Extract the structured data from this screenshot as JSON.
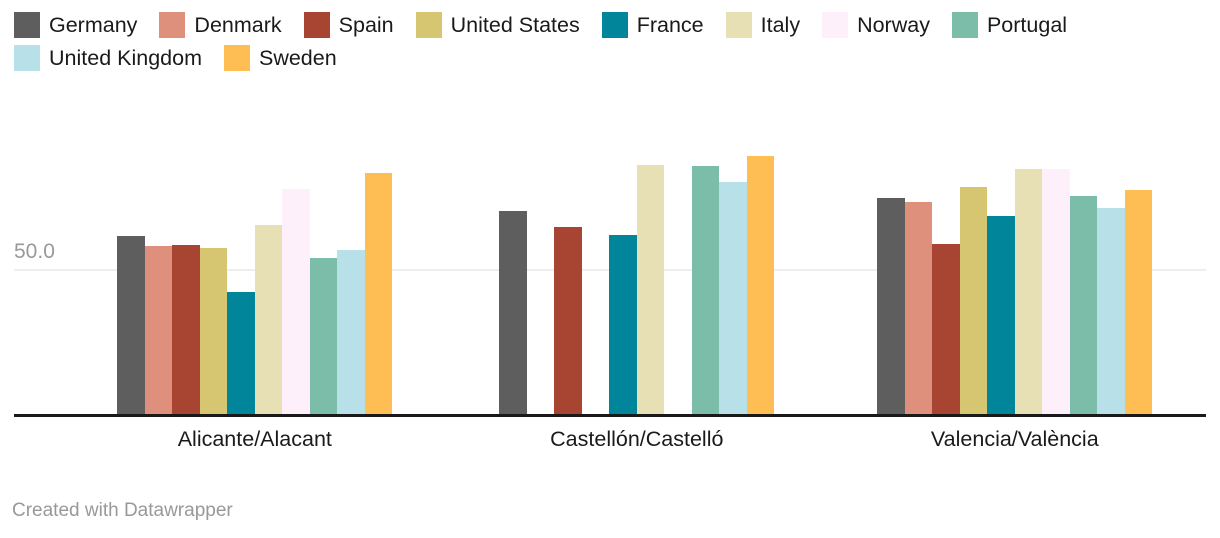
{
  "legend": {
    "items": [
      {
        "label": "Germany",
        "color": "#5e5e5e"
      },
      {
        "label": "Denmark",
        "color": "#df907c"
      },
      {
        "label": "Spain",
        "color": "#a84432"
      },
      {
        "label": "United States",
        "color": "#d6c571"
      },
      {
        "label": "France",
        "color": "#00859a"
      },
      {
        "label": "Italy",
        "color": "#e6e0b4"
      },
      {
        "label": "Norway",
        "color": "#fdf0fa"
      },
      {
        "label": "Portugal",
        "color": "#7cbda9"
      },
      {
        "label": "United Kingdom",
        "color": "#b8e0e8"
      },
      {
        "label": "Sweden",
        "color": "#ffbe54"
      }
    ]
  },
  "axis": {
    "y_ticks": [
      {
        "label": "50.0",
        "value": 50
      }
    ],
    "gridline_color": "#eeeeee",
    "baseline_color": "#1a1a1a"
  },
  "footer": {
    "credit": "Created with Datawrapper"
  },
  "chart_data": {
    "type": "bar",
    "title": "",
    "subtitle": "",
    "xlabel": "",
    "ylabel": "",
    "ylim": [
      0,
      95
    ],
    "grid": true,
    "legend_position": "top",
    "categories": [
      "Alicante/Alacant",
      "Castellón/Castelló",
      "Valencia/València"
    ],
    "series": [
      {
        "name": "Germany",
        "color": "#5e5e5e",
        "values": [
          61.6,
          70.0,
          74.7
        ]
      },
      {
        "name": "Denmark",
        "color": "#df907c",
        "values": [
          58.1,
          null,
          73.2
        ]
      },
      {
        "name": "Spain",
        "color": "#a84432",
        "values": [
          58.4,
          64.6,
          58.8
        ]
      },
      {
        "name": "United States",
        "color": "#d6c571",
        "values": [
          57.4,
          null,
          78.5
        ]
      },
      {
        "name": "France",
        "color": "#00859a",
        "values": [
          42.1,
          61.7,
          68.4
        ]
      },
      {
        "name": "Italy",
        "color": "#e6e0b4",
        "values": [
          65.2,
          86.0,
          84.6
        ]
      },
      {
        "name": "Norway",
        "color": "#fdf0fa",
        "values": [
          77.8,
          null,
          84.8
        ]
      },
      {
        "name": "Portugal",
        "color": "#7cbda9",
        "values": [
          53.9,
          85.7,
          75.5
        ]
      },
      {
        "name": "United Kingdom",
        "color": "#b8e0e8",
        "values": [
          56.7,
          80.2,
          71.2
        ]
      },
      {
        "name": "Sweden",
        "color": "#ffbe54",
        "values": [
          83.2,
          89.2,
          77.5
        ]
      }
    ]
  }
}
